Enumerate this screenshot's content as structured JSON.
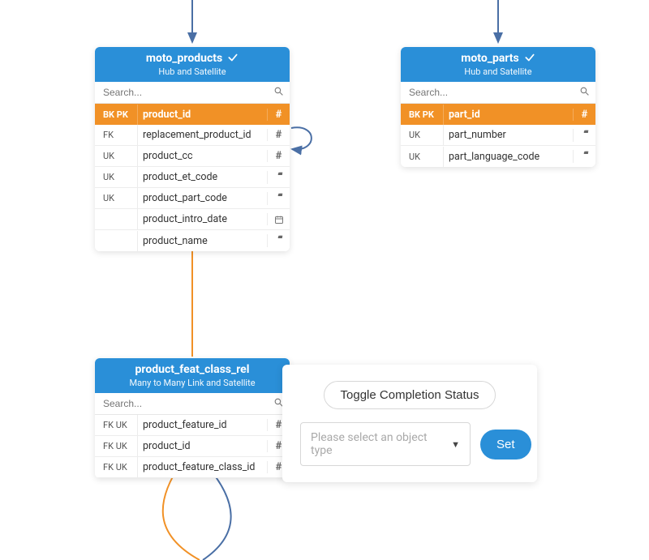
{
  "colors": {
    "header_blue": "#2a8fd8",
    "key_row_orange": "#f19126",
    "connector_blue": "#4a6fa5",
    "connector_orange": "#f19126"
  },
  "entities": {
    "moto_products": {
      "title": "moto_products",
      "subtitle": "Hub and Satellite",
      "search_placeholder": "Search...",
      "rows": [
        {
          "keys": "BK PK",
          "name": "product_id",
          "type": "hash",
          "header": true
        },
        {
          "keys": "FK",
          "name": "replacement_product_id",
          "type": "hash"
        },
        {
          "keys": "UK",
          "name": "product_cc",
          "type": "hash"
        },
        {
          "keys": "UK",
          "name": "product_et_code",
          "type": "text"
        },
        {
          "keys": "UK",
          "name": "product_part_code",
          "type": "text"
        },
        {
          "keys": "",
          "name": "product_intro_date",
          "type": "date"
        },
        {
          "keys": "",
          "name": "product_name",
          "type": "text"
        }
      ]
    },
    "moto_parts": {
      "title": "moto_parts",
      "subtitle": "Hub and Satellite",
      "search_placeholder": "Search...",
      "rows": [
        {
          "keys": "BK PK",
          "name": "part_id",
          "type": "hash",
          "header": true
        },
        {
          "keys": "UK",
          "name": "part_number",
          "type": "text"
        },
        {
          "keys": "UK",
          "name": "part_language_code",
          "type": "text"
        }
      ]
    },
    "product_feat_class_rel": {
      "title": "product_feat_class_rel",
      "subtitle": "Many to Many Link and Satellite",
      "search_placeholder": "Search...",
      "rows": [
        {
          "keys": "FK UK",
          "name": "product_feature_id",
          "type": "hash"
        },
        {
          "keys": "FK UK",
          "name": "product_id",
          "type": "hash"
        },
        {
          "keys": "FK UK",
          "name": "product_feature_class_id",
          "type": "hash"
        }
      ]
    }
  },
  "panel": {
    "toggle_label": "Toggle Completion Status",
    "select_placeholder": "Please select an object type",
    "set_label": "Set"
  }
}
